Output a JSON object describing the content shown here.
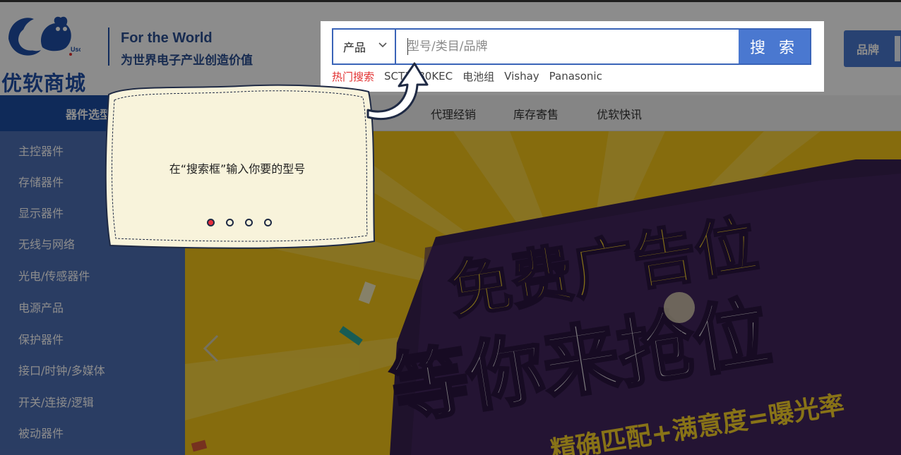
{
  "header": {
    "logo_text": "优软商城",
    "logo_badge": "Usoft MALL",
    "slogan_en": "For the World",
    "slogan_cn": "为世界电子产业创造价值"
  },
  "search": {
    "scope": "产品",
    "placeholder": "型号/类目/品牌",
    "button_label": "搜 索",
    "hot_label": "热门搜索",
    "hot_items": [
      "SCT3080KEC",
      "电池组",
      "Vishay",
      "Panasonic"
    ]
  },
  "brand_button": {
    "label": "品牌"
  },
  "nav": {
    "category_label": "器件选型",
    "items": [
      "代理经销",
      "库存寄售",
      "优软快讯"
    ]
  },
  "sidebar": {
    "items": [
      "主控器件",
      "存储器件",
      "显示器件",
      "无线与网络",
      "光电/传感器件",
      "电源产品",
      "保护器件",
      "接口/时钟/多媒体",
      "开关/连接/逻辑",
      "被动器件"
    ]
  },
  "banner": {
    "line1": "免费广告位",
    "line2": "等你来抢位",
    "line3": "精确匹配+满意度=曝光率"
  },
  "tour": {
    "message": "在“搜索框”输入你要的型号",
    "total_steps": 4,
    "current_step": 1
  },
  "colors": {
    "brand_blue": "#1d4ea3",
    "button_blue": "#4a78d0",
    "hot_red": "#e23030",
    "banner_yellow": "#f5c519",
    "banner_purple": "#3a2150",
    "tip_bg": "#f8f3db"
  }
}
